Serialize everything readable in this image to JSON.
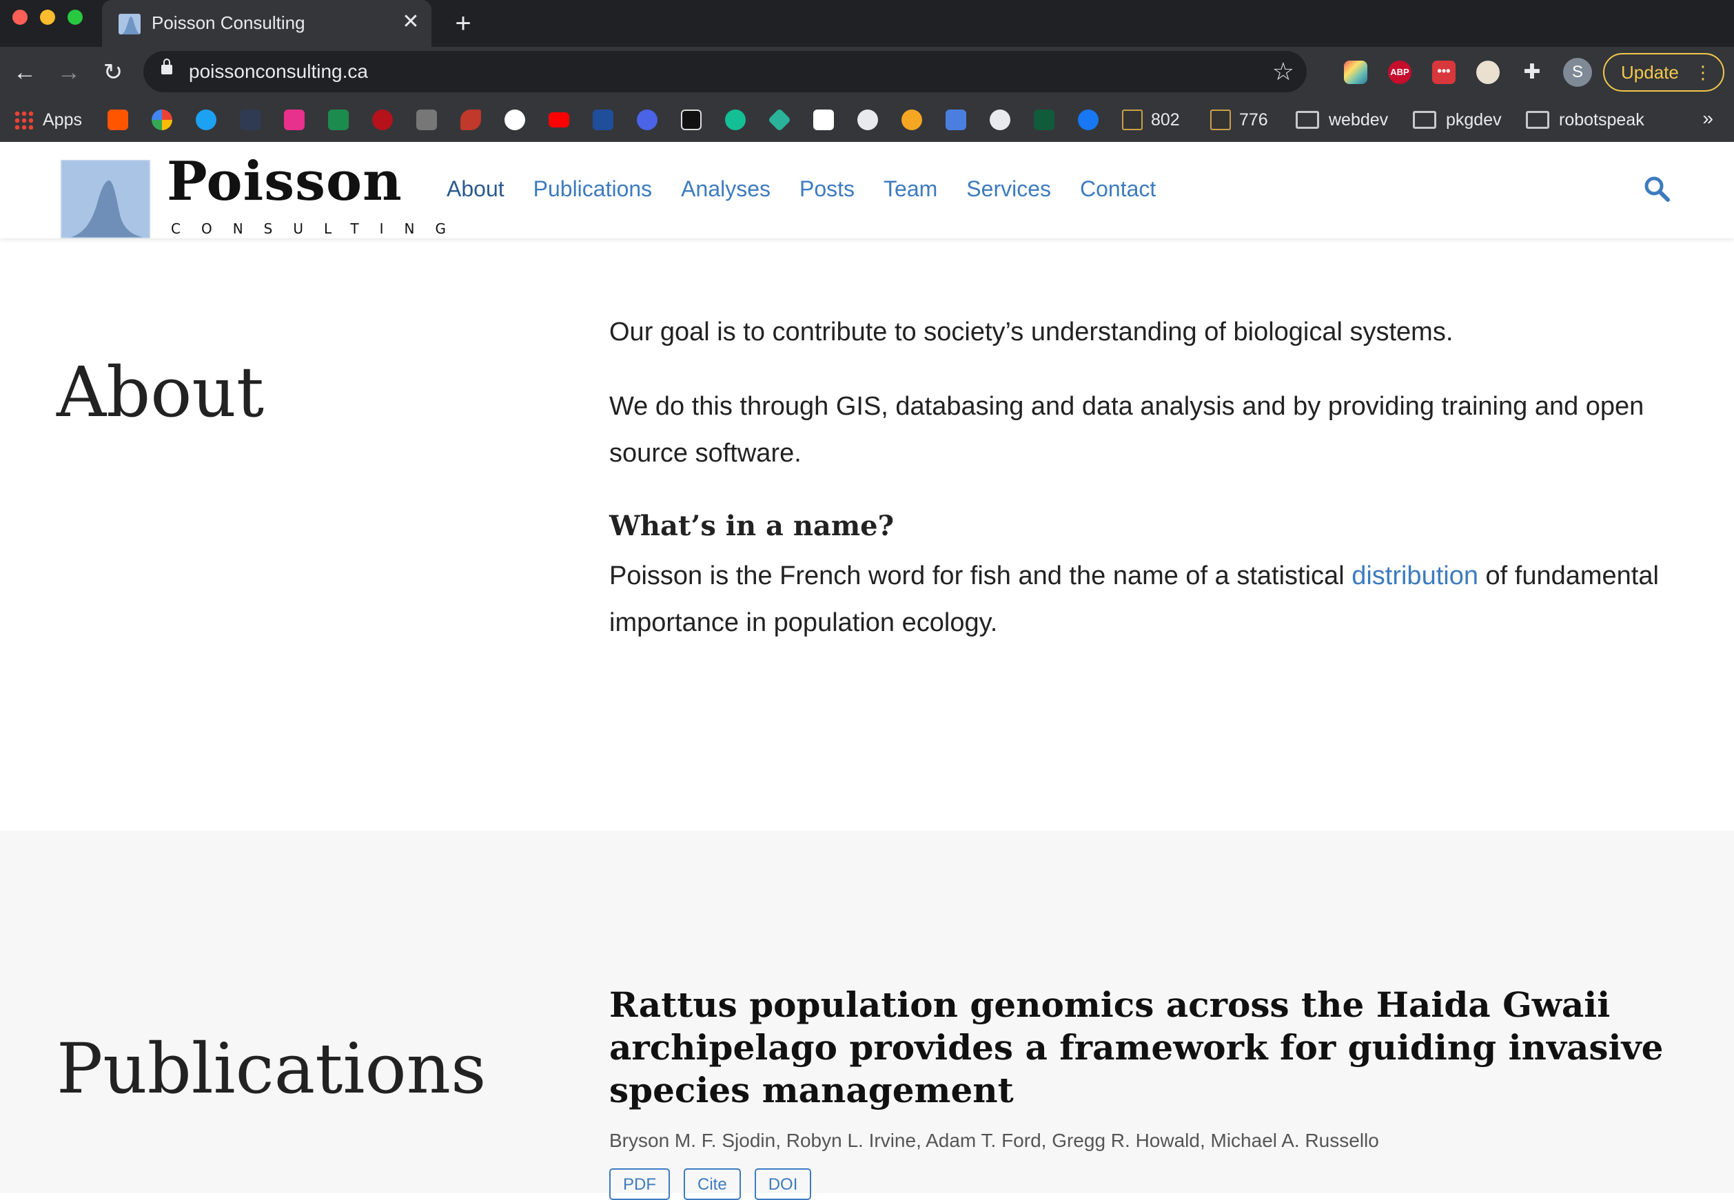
{
  "browser": {
    "tab_title": "Poisson Consulting",
    "url": "poissonconsulting.ca",
    "new_tab_symbol": "+",
    "close_symbol": "✕",
    "profile_initial": "S",
    "update_label": "Update",
    "bookmarks": [
      {
        "label": "Apps",
        "icon": "apps-grid-icon"
      },
      {
        "label": "802",
        "icon": "blackboard-icon"
      },
      {
        "label": "776",
        "icon": "blackboard-icon"
      },
      {
        "label": "webdev",
        "icon": "folder-icon"
      },
      {
        "label": "pkgdev",
        "icon": "folder-icon"
      },
      {
        "label": "robotspeak",
        "icon": "folder-icon"
      }
    ],
    "bookmark_more": "»"
  },
  "site": {
    "logo_word": "Poisson",
    "logo_sub": "CONSULTING",
    "nav": [
      {
        "label": "About",
        "active": true
      },
      {
        "label": "Publications"
      },
      {
        "label": "Analyses"
      },
      {
        "label": "Posts"
      },
      {
        "label": "Team"
      },
      {
        "label": "Services"
      },
      {
        "label": "Contact"
      }
    ],
    "accent_color": "#3d7bbf"
  },
  "about": {
    "title": "About",
    "p1": "Our goal is to contribute to society’s understanding of biological systems.",
    "p2": "We do this through GIS, databasing and data analysis and by providing training and open source software.",
    "subheading": "What’s in a name?",
    "p3_before": "Poisson is the French word for fish and the name of a statistical ",
    "p3_link": "distribution",
    "p3_after": " of fundamental importance in population ecology."
  },
  "publications": {
    "title": "Publications",
    "items": [
      {
        "title": "Rattus population genomics across the Haida Gwaii archipelago provides a framework for guiding invasive species management",
        "authors": "Bryson M. F. Sjodin, Robyn L. Irvine, Adam T. Ford, Gregg R. Howald, Michael A. Russello",
        "buttons": [
          "PDF",
          "Cite",
          "DOI"
        ]
      }
    ]
  }
}
